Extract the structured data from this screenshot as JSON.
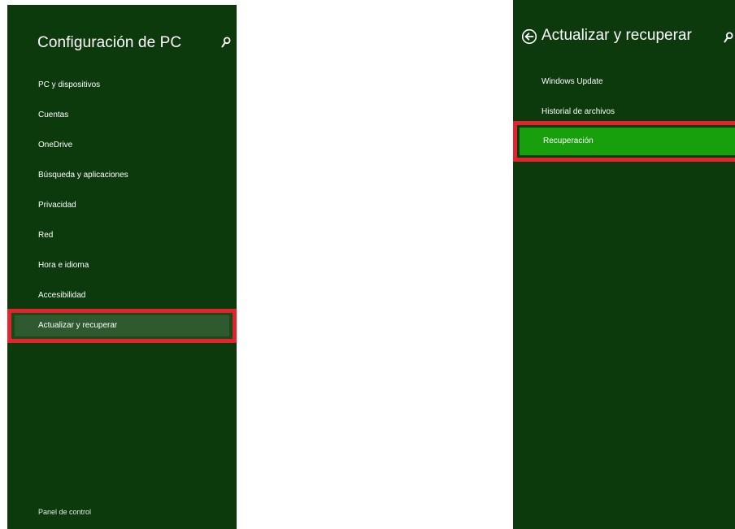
{
  "left_panel": {
    "title": "Configuración de PC",
    "search_icon": "search-icon",
    "items": [
      {
        "label": "PC y dispositivos"
      },
      {
        "label": "Cuentas"
      },
      {
        "label": "OneDrive"
      },
      {
        "label": "Búsqueda y aplicaciones"
      },
      {
        "label": "Privacidad"
      },
      {
        "label": "Red"
      },
      {
        "label": "Hora e idioma"
      },
      {
        "label": "Accesibilidad"
      }
    ],
    "selected_item": {
      "label": "Actualizar y recuperar"
    },
    "footer_link": "Panel de control"
  },
  "right_panel": {
    "back_icon": "back-arrow-circle-icon",
    "title": "Actualizar y recuperar",
    "search_icon": "search-icon",
    "items": [
      {
        "label": "Windows Update"
      },
      {
        "label": "Historial de archivos"
      }
    ],
    "selected_item": {
      "label": "Recuperación"
    }
  },
  "colors": {
    "panel_background": "#0c3a0c",
    "left_selected_background": "#2f5a2f",
    "right_selected_background": "#17a00c",
    "highlight_border": "#e4232e",
    "text": "#ffffff",
    "page_background": "#ffffff"
  }
}
